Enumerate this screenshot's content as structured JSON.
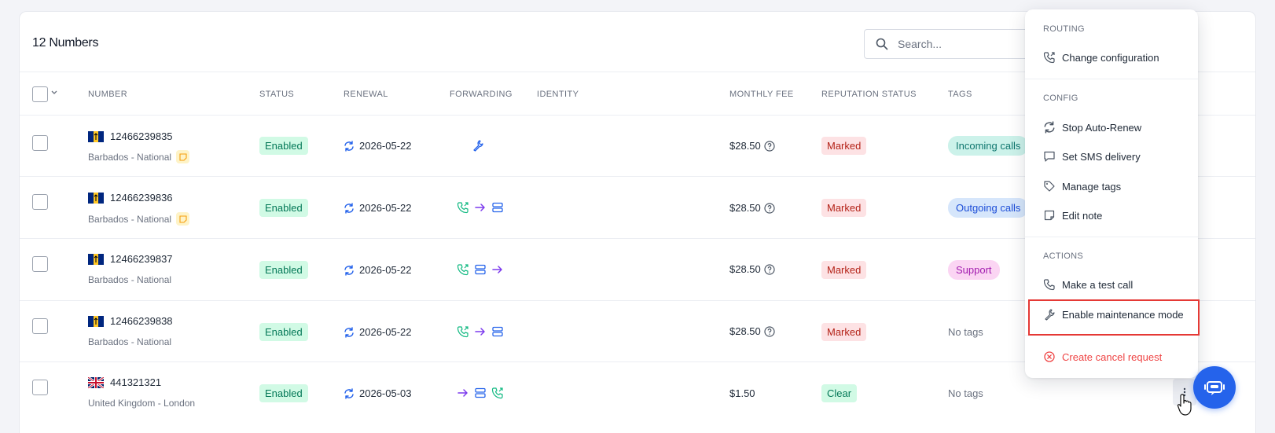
{
  "header": {
    "title": "12 Numbers",
    "search_placeholder": "Search..."
  },
  "columns": {
    "number": "NUMBER",
    "status": "STATUS",
    "renewal": "RENEWAL",
    "forwarding": "FORWARDING",
    "identity": "IDENTITY",
    "monthly_fee": "MONTHLY FEE",
    "reputation_status": "REPUTATION STATUS",
    "tags": "TAGS"
  },
  "rows": [
    {
      "number": "12466239835",
      "flag": "barbados-flag",
      "location": "Barbados - National",
      "has_note": true,
      "status": "Enabled",
      "renewal": "2026-05-22",
      "forwarding": [
        "wrench-icon"
      ],
      "fee": "$28.50",
      "fee_help": true,
      "reputation": "Marked",
      "tag": "Incoming calls",
      "tag_color": "green"
    },
    {
      "number": "12466239836",
      "flag": "barbados-flag",
      "location": "Barbados - National",
      "has_note": true,
      "status": "Enabled",
      "renewal": "2026-05-22",
      "forwarding": [
        "phone-forward-icon",
        "arrow-right-icon",
        "server-icon"
      ],
      "fee": "$28.50",
      "fee_help": true,
      "reputation": "Marked",
      "tag": "Outgoing calls",
      "tag_color": "blue"
    },
    {
      "number": "12466239837",
      "flag": "barbados-flag",
      "location": "Barbados - National",
      "has_note": false,
      "status": "Enabled",
      "renewal": "2026-05-22",
      "forwarding": [
        "phone-forward-icon",
        "server-icon",
        "arrow-right-icon"
      ],
      "fee": "$28.50",
      "fee_help": true,
      "reputation": "Marked",
      "tag": "Support",
      "tag_color": "pink"
    },
    {
      "number": "12466239838",
      "flag": "barbados-flag",
      "location": "Barbados - National",
      "has_note": false,
      "status": "Enabled",
      "renewal": "2026-05-22",
      "forwarding": [
        "phone-forward-icon",
        "arrow-right-icon",
        "server-icon"
      ],
      "fee": "$28.50",
      "fee_help": true,
      "reputation": "Marked",
      "tag": "No tags",
      "tag_color": ""
    },
    {
      "number": "441321321",
      "flag": "uk-flag",
      "location": "United Kingdom - London",
      "has_note": false,
      "status": "Enabled",
      "renewal": "2026-05-03",
      "forwarding": [
        "arrow-right-icon",
        "server-icon",
        "phone-forward-icon"
      ],
      "fee": "$1.50",
      "fee_help": false,
      "reputation": "Clear",
      "tag": "No tags",
      "tag_color": ""
    }
  ],
  "menu": {
    "routing_label": "ROUTING",
    "change_configuration": "Change configuration",
    "config_label": "CONFIG",
    "stop_auto_renew": "Stop Auto-Renew",
    "set_sms_delivery": "Set SMS delivery",
    "manage_tags": "Manage tags",
    "edit_note": "Edit note",
    "actions_label": "ACTIONS",
    "make_test_call": "Make a test call",
    "enable_maintenance_mode": "Enable maintenance mode",
    "create_cancel_request": "Create cancel request"
  },
  "colors": {
    "accent": "#2563eb",
    "enabled_bg": "#d1fae5",
    "marked_bg": "#fde2e4",
    "danger": "#ef4444",
    "highlight": "#e53935"
  }
}
